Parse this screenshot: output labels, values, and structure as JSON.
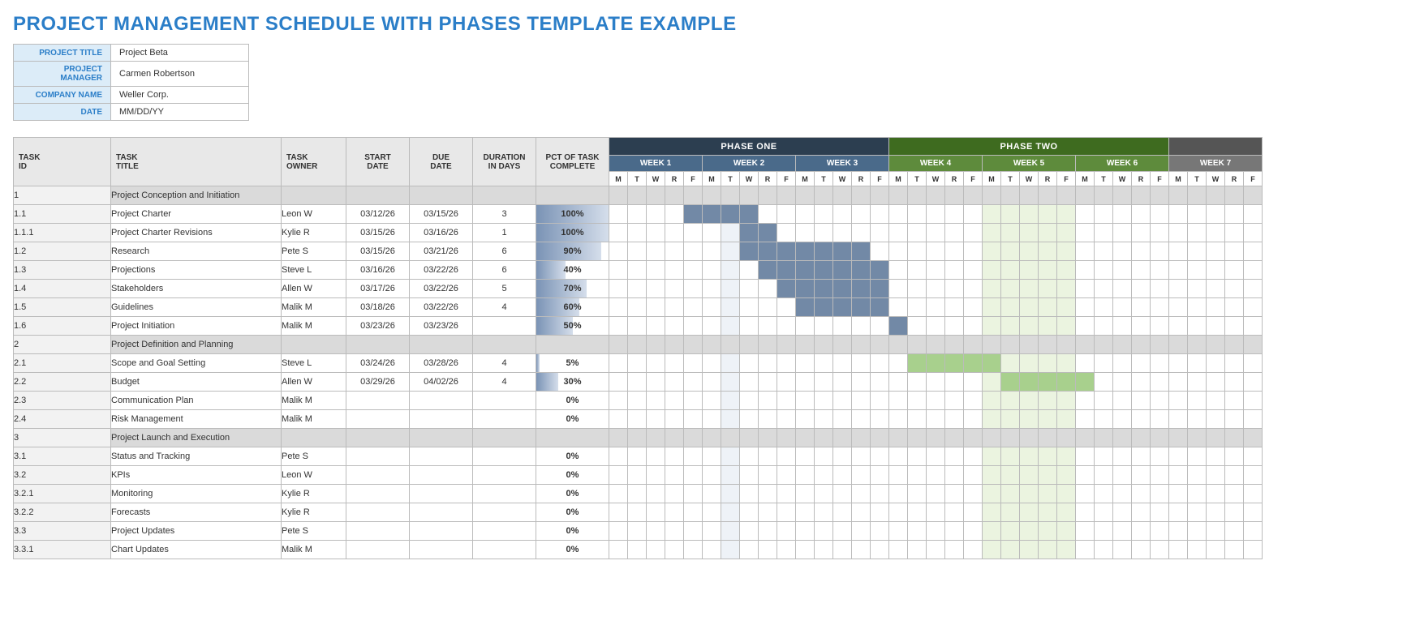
{
  "title": "PROJECT MANAGEMENT SCHEDULE WITH PHASES TEMPLATE EXAMPLE",
  "meta": {
    "labels": {
      "project_title": "PROJECT TITLE",
      "pm": "PROJECT MANAGER",
      "company": "COMPANY NAME",
      "date": "DATE"
    },
    "values": {
      "project_title": "Project Beta",
      "pm": "Carmen Robertson",
      "company": "Weller Corp.",
      "date": "MM/DD/YY"
    }
  },
  "columns": {
    "id_l1": "TASK",
    "id_l2": "ID",
    "title_l1": "TASK",
    "title_l2": "TITLE",
    "owner_l1": "TASK",
    "owner_l2": "OWNER",
    "start_l1": "START",
    "start_l2": "DATE",
    "due_l1": "DUE",
    "due_l2": "DATE",
    "dur_l1": "DURATION",
    "dur_l2": "IN DAYS",
    "pct_l1": "PCT OF TASK",
    "pct_l2": "COMPLETE"
  },
  "phases": [
    {
      "label": "PHASE ONE",
      "class": "phase1",
      "wk": "wk-p1",
      "tint": "tint-p1",
      "bar": "bar-p1",
      "weeks": [
        "WEEK 1",
        "WEEK 2",
        "WEEK 3"
      ]
    },
    {
      "label": "PHASE TWO",
      "class": "phase2",
      "wk": "wk-p2",
      "tint": "tint-p2",
      "bar": "bar-p2",
      "weeks": [
        "WEEK 4",
        "WEEK 5",
        "WEEK 6"
      ]
    },
    {
      "label": "",
      "class": "phase3",
      "wk": "wk-p3",
      "tint": "",
      "bar": "",
      "weeks": [
        "WEEK 7"
      ]
    }
  ],
  "days": [
    "M",
    "T",
    "W",
    "R",
    "F"
  ],
  "rows": [
    {
      "id": "1",
      "title": "Project Conception and Initiation",
      "section": true
    },
    {
      "id": "1.1",
      "title": "Project Charter",
      "indent": 1,
      "owner": "Leon W",
      "start": "03/12/26",
      "due": "03/15/26",
      "dur": "3",
      "pct": 100,
      "gantt_start": 4,
      "gantt_len": 4,
      "bar": "bar-p1"
    },
    {
      "id": "1.1.1",
      "title": "Project Charter Revisions",
      "indent": 2,
      "owner": "Kylie R",
      "start": "03/15/26",
      "due": "03/16/26",
      "dur": "1",
      "pct": 100,
      "gantt_start": 7,
      "gantt_len": 2,
      "bar": "bar-p1"
    },
    {
      "id": "1.2",
      "title": "Research",
      "indent": 1,
      "owner": "Pete S",
      "start": "03/15/26",
      "due": "03/21/26",
      "dur": "6",
      "pct": 90,
      "gantt_start": 7,
      "gantt_len": 7,
      "bar": "bar-p1"
    },
    {
      "id": "1.3",
      "title": "Projections",
      "indent": 1,
      "owner": "Steve L",
      "start": "03/16/26",
      "due": "03/22/26",
      "dur": "6",
      "pct": 40,
      "gantt_start": 8,
      "gantt_len": 7,
      "bar": "bar-p1"
    },
    {
      "id": "1.4",
      "title": "Stakeholders",
      "indent": 1,
      "owner": "Allen W",
      "start": "03/17/26",
      "due": "03/22/26",
      "dur": "5",
      "pct": 70,
      "gantt_start": 9,
      "gantt_len": 6,
      "bar": "bar-p1"
    },
    {
      "id": "1.5",
      "title": "Guidelines",
      "indent": 1,
      "owner": "Malik M",
      "start": "03/18/26",
      "due": "03/22/26",
      "dur": "4",
      "pct": 60,
      "gantt_start": 10,
      "gantt_len": 5,
      "bar": "bar-p1"
    },
    {
      "id": "1.6",
      "title": "Project Initiation",
      "indent": 1,
      "owner": "Malik M",
      "start": "03/23/26",
      "due": "03/23/26",
      "dur": "",
      "pct": 50,
      "gantt_start": 15,
      "gantt_len": 1,
      "bar": "bar-p1"
    },
    {
      "id": "2",
      "title": "Project Definition and Planning",
      "section": true
    },
    {
      "id": "2.1",
      "title": "Scope and Goal Setting",
      "indent": 1,
      "owner": "Steve L",
      "start": "03/24/26",
      "due": "03/28/26",
      "dur": "4",
      "pct": 5,
      "gantt_start": 16,
      "gantt_len": 5,
      "bar": "bar-p2"
    },
    {
      "id": "2.2",
      "title": "Budget",
      "indent": 1,
      "owner": "Allen W",
      "start": "03/29/26",
      "due": "04/02/26",
      "dur": "4",
      "pct": 30,
      "gantt_start": 21,
      "gantt_len": 5,
      "bar": "bar-p2"
    },
    {
      "id": "2.3",
      "title": "Communication Plan",
      "indent": 1,
      "owner": "Malik M",
      "pct": 0
    },
    {
      "id": "2.4",
      "title": "Risk Management",
      "indent": 1,
      "owner": "Malik M",
      "pct": 0
    },
    {
      "id": "3",
      "title": "Project Launch and Execution",
      "section": true
    },
    {
      "id": "3.1",
      "title": "Status and Tracking",
      "indent": 1,
      "owner": "Pete S",
      "pct": 0
    },
    {
      "id": "3.2",
      "title": "KPIs",
      "indent": 1,
      "owner": "Leon W",
      "pct": 0
    },
    {
      "id": "3.2.1",
      "title": "Monitoring",
      "indent": 2,
      "owner": "Kylie R",
      "pct": 0
    },
    {
      "id": "3.2.2",
      "title": "Forecasts",
      "indent": 2,
      "owner": "Kylie R",
      "pct": 0
    },
    {
      "id": "3.3",
      "title": "Project Updates",
      "indent": 1,
      "owner": "Pete S",
      "pct": 0
    },
    {
      "id": "3.3.1",
      "title": "Chart Updates",
      "indent": 2,
      "owner": "Malik M",
      "pct": 0
    }
  ],
  "week2_tint_col": 6,
  "week5_tint_start": 20,
  "week5_tint_len": 5
}
